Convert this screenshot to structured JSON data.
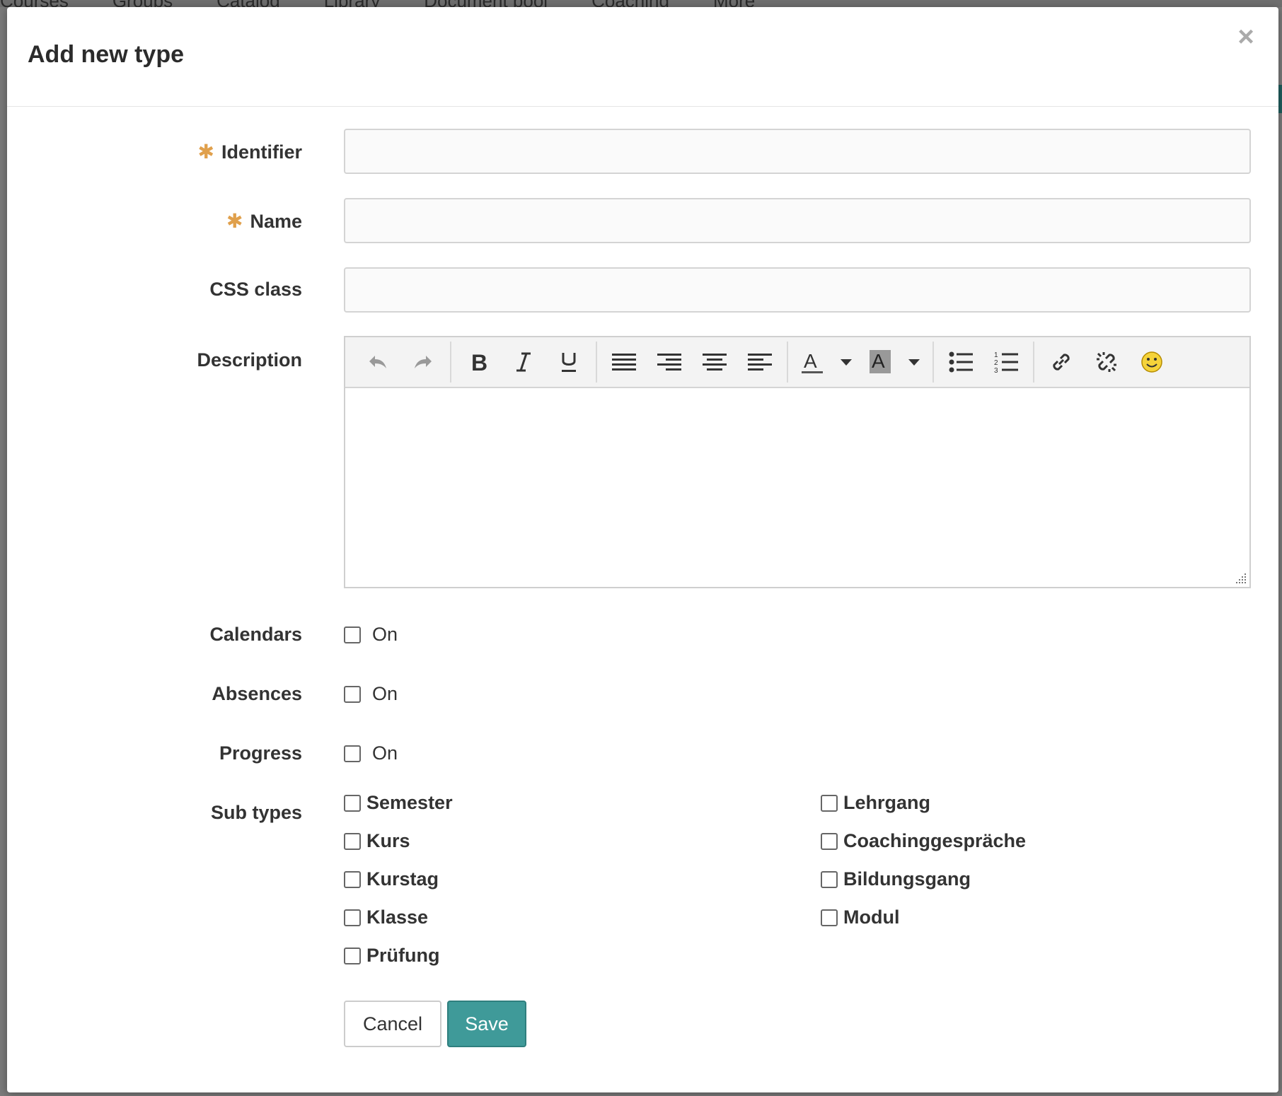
{
  "background": {
    "nav": [
      "Courses",
      "Groups",
      "Catalog",
      "Library",
      "Document pool",
      "Coaching",
      "More"
    ]
  },
  "modal": {
    "title": "Add new type",
    "close_label": "×"
  },
  "form": {
    "required_marker": "✱",
    "identifier": {
      "label": "Identifier",
      "value": "",
      "required": true
    },
    "name": {
      "label": "Name",
      "value": "",
      "required": true
    },
    "css_class": {
      "label": "CSS class",
      "value": ""
    },
    "description": {
      "label": "Description",
      "toolbar": [
        "undo",
        "redo",
        "bold",
        "italic",
        "underline",
        "align-justify",
        "align-right",
        "align-center",
        "align-left",
        "text-color",
        "background-color",
        "bullet-list",
        "numbered-list",
        "insert-link",
        "remove-link",
        "emoticons"
      ]
    },
    "calendars": {
      "label": "Calendars",
      "option": "On",
      "checked": false
    },
    "absences": {
      "label": "Absences",
      "option": "On",
      "checked": false
    },
    "progress": {
      "label": "Progress",
      "option": "On",
      "checked": false
    },
    "sub_types": {
      "label": "Sub types",
      "options": [
        "Semester",
        "Lehrgang",
        "Kurs",
        "Coachinggespräche",
        "Kurstag",
        "Bildungsgang",
        "Klasse",
        "Modul",
        "Prüfung"
      ]
    },
    "cancel_label": "Cancel",
    "save_label": "Save"
  },
  "colors": {
    "accent": "#3f9a99",
    "required": "#e0a04c"
  }
}
